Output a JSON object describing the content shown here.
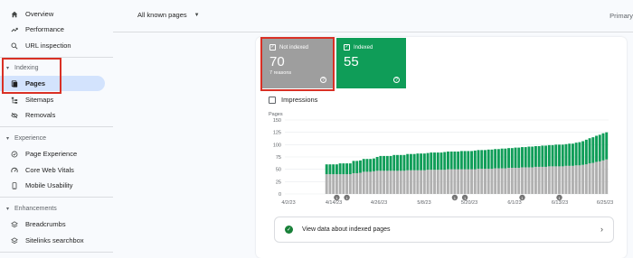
{
  "sidebar": {
    "items_top": [
      {
        "label": "Overview",
        "icon": "home-icon"
      },
      {
        "label": "Performance",
        "icon": "trending-up-icon"
      },
      {
        "label": "URL inspection",
        "icon": "search-icon"
      }
    ],
    "indexing": {
      "header": "Indexing",
      "items": [
        {
          "label": "Pages",
          "icon": "pages-icon"
        },
        {
          "label": "Sitemaps",
          "icon": "sitemap-icon"
        },
        {
          "label": "Removals",
          "icon": "removals-icon"
        }
      ]
    },
    "experience": {
      "header": "Experience",
      "items": [
        {
          "label": "Page Experience",
          "icon": "page-experience-icon"
        },
        {
          "label": "Core Web Vitals",
          "icon": "speed-icon"
        },
        {
          "label": "Mobile Usability",
          "icon": "phone-icon"
        }
      ]
    },
    "enhancements": {
      "header": "Enhancements",
      "items": [
        {
          "label": "Breadcrumbs",
          "icon": "layers-icon"
        },
        {
          "label": "Sitelinks searchbox",
          "icon": "layers-icon"
        }
      ]
    }
  },
  "topbar": {
    "filter_label": "All known pages",
    "primary_label": "Primary"
  },
  "tiles": {
    "not_indexed": {
      "label": "Not indexed",
      "value": "70",
      "sub": "7 reasons",
      "color": "#9e9e9e"
    },
    "indexed": {
      "label": "Indexed",
      "value": "55",
      "color": "#0f9d58"
    }
  },
  "impressions_label": "Impressions",
  "link_row_label": "View data about indexed pages",
  "chart_data": {
    "type": "bar",
    "ylabel": "Pages",
    "yticks": [
      0,
      25,
      50,
      75,
      100,
      125,
      150
    ],
    "ylim": [
      0,
      150
    ],
    "xtick_labels": [
      "4/2/23",
      "4/14/23",
      "4/26/23",
      "5/8/23",
      "5/20/23",
      "6/1/23",
      "6/13/23",
      "6/25/23"
    ],
    "annotation_marker": "1",
    "annotation_days": [
      3,
      6,
      38,
      41,
      58,
      69
    ],
    "series": [
      {
        "name": "Indexed",
        "color": "#0f9d58",
        "values": [
          20,
          20,
          20,
          20,
          22,
          22,
          22,
          22,
          25,
          25,
          25,
          26,
          26,
          26,
          26,
          28,
          30,
          30,
          30,
          30,
          32,
          32,
          32,
          32,
          33,
          33,
          33,
          34,
          34,
          34,
          34,
          35,
          35,
          35,
          35,
          36,
          36,
          36,
          36,
          36,
          37,
          37,
          37,
          37,
          38,
          38,
          38,
          38,
          39,
          39,
          39,
          39,
          40,
          40,
          40,
          40,
          41,
          41,
          41,
          41,
          42,
          42,
          42,
          42,
          43,
          43,
          43,
          43,
          44,
          44,
          44,
          44,
          45,
          45,
          46,
          47,
          48,
          50,
          51,
          52,
          53,
          54,
          55,
          55
        ]
      },
      {
        "name": "Not indexed",
        "color": "#b0b0b0",
        "values": [
          40,
          40,
          40,
          40,
          40,
          40,
          40,
          40,
          42,
          42,
          43,
          45,
          45,
          45,
          46,
          47,
          47,
          47,
          47,
          47,
          47,
          47,
          47,
          47,
          48,
          48,
          48,
          48,
          48,
          48,
          49,
          49,
          49,
          49,
          49,
          49,
          50,
          50,
          50,
          50,
          50,
          50,
          50,
          50,
          50,
          51,
          51,
          51,
          51,
          51,
          52,
          52,
          52,
          52,
          53,
          53,
          53,
          53,
          54,
          54,
          54,
          54,
          55,
          55,
          55,
          55,
          56,
          56,
          56,
          56,
          56,
          57,
          57,
          57,
          58,
          58,
          59,
          60,
          62,
          63,
          65,
          66,
          68,
          70
        ]
      }
    ]
  }
}
